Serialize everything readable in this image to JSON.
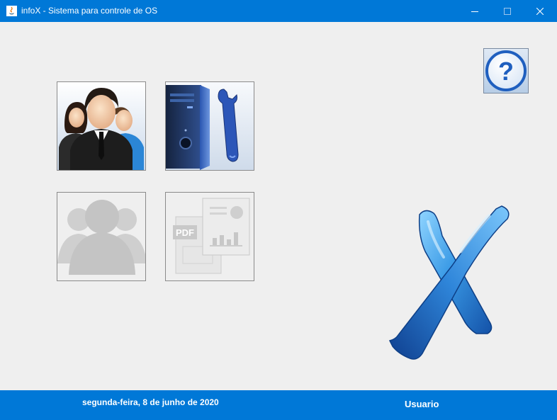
{
  "window": {
    "title": "infoX - Sistema para controle de OS",
    "controls": {
      "minimize": "minimize-icon",
      "maximize": "maximize-icon",
      "close": "close-icon"
    }
  },
  "toolbar": {
    "tiles": [
      {
        "name": "users",
        "icon": "users-icon",
        "enabled": true
      },
      {
        "name": "service-orders",
        "icon": "computer-wrench-icon",
        "enabled": true
      },
      {
        "name": "clients",
        "icon": "clients-icon",
        "enabled": false
      },
      {
        "name": "reports",
        "icon": "pdf-report-icon",
        "enabled": false
      }
    ],
    "help_icon": "help-icon",
    "help_glyph": "?",
    "pdf_label": "PDF"
  },
  "footer": {
    "date": "segunda-feira, 8 de junho de 2020",
    "user": "Usuario"
  },
  "colors": {
    "accent": "#0078d7",
    "background": "#efefef"
  }
}
